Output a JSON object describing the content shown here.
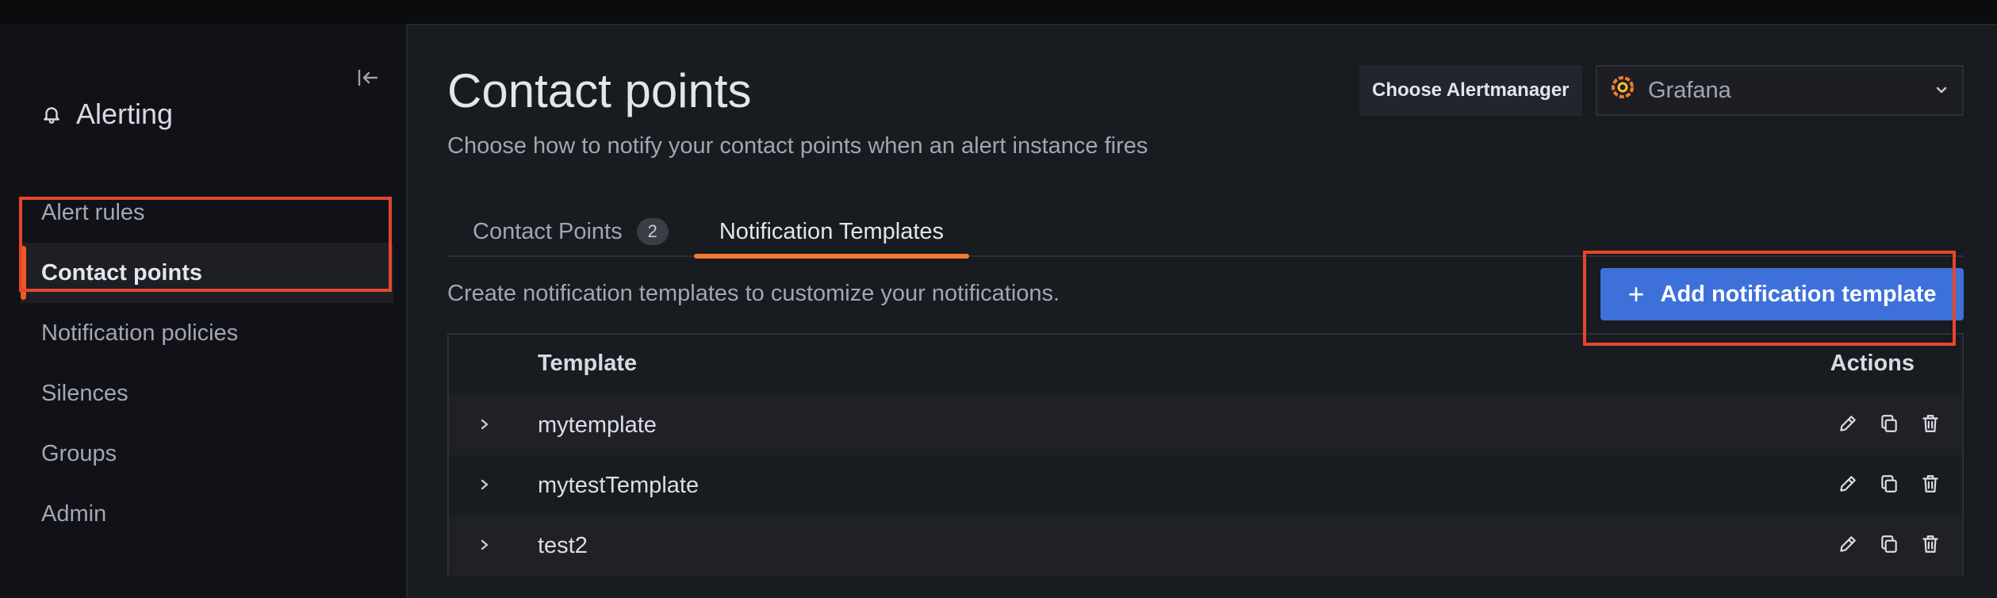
{
  "sidebar": {
    "section_title": "Alerting",
    "items": [
      {
        "label": "Alert rules",
        "active": false
      },
      {
        "label": "Contact points",
        "active": true
      },
      {
        "label": "Notification policies",
        "active": false
      },
      {
        "label": "Silences",
        "active": false
      },
      {
        "label": "Groups",
        "active": false
      },
      {
        "label": "Admin",
        "active": false
      }
    ]
  },
  "header": {
    "title": "Contact points",
    "subtitle": "Choose how to notify your contact points when an alert instance fires",
    "alertmanager_label": "Choose Alertmanager",
    "alertmanager_value": "Grafana"
  },
  "tabs": [
    {
      "label": "Contact Points",
      "count": "2",
      "active": false
    },
    {
      "label": "Notification Templates",
      "active": true
    }
  ],
  "templates": {
    "description": "Create notification templates to customize your notifications.",
    "add_button": "Add notification template",
    "columns": {
      "name": "Template",
      "actions": "Actions"
    },
    "rows": [
      {
        "name": "mytemplate"
      },
      {
        "name": "mytestTemplate"
      },
      {
        "name": "test2"
      }
    ]
  },
  "colors": {
    "accent": "#f05a28",
    "primary_button": "#3d71d9",
    "highlight_box": "#e5462a"
  },
  "icons": {
    "collapse": "collapse-left-icon",
    "bell": "bell-icon",
    "grafana": "grafana-logo-icon",
    "chevron": "chevron-down-icon",
    "expand": "chevron-right-icon",
    "edit": "pencil-icon",
    "copy": "copy-icon",
    "delete": "trash-icon",
    "add": "plus-icon"
  }
}
